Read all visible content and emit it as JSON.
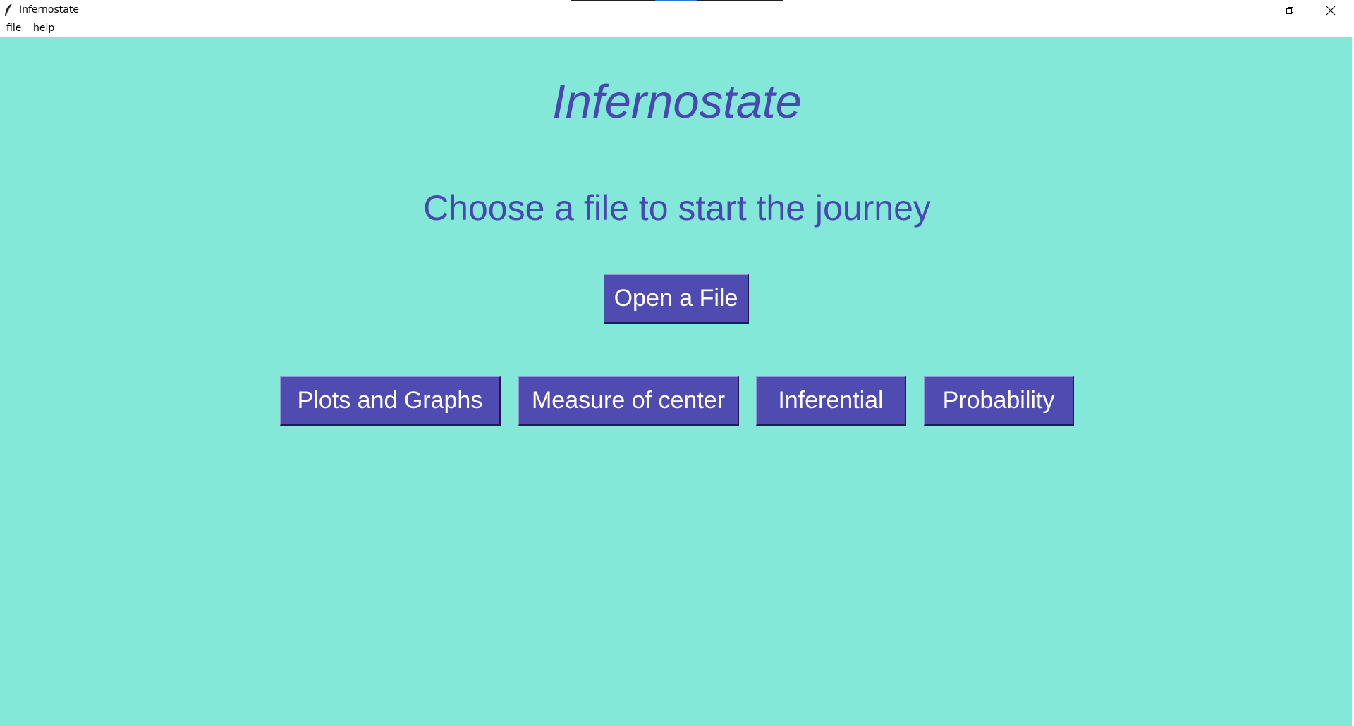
{
  "window": {
    "title": "Infernostate",
    "controls": {
      "minimize": "minimize-icon",
      "maximize": "restore-icon",
      "close": "close-icon"
    }
  },
  "menu": {
    "file": "file",
    "help": "help"
  },
  "main": {
    "title": "Infernostate",
    "subtitle": "Choose a file to start the journey",
    "open_button": "Open a File",
    "buttons": [
      {
        "label": "Plots and Graphs"
      },
      {
        "label": "Measure of center"
      },
      {
        "label": "Inferential"
      },
      {
        "label": "Probability"
      }
    ]
  },
  "colors": {
    "background": "#84e8d8",
    "accent_text": "#4a46b2",
    "button_bg": "#4f4bb0",
    "button_text": "#ffffff"
  }
}
